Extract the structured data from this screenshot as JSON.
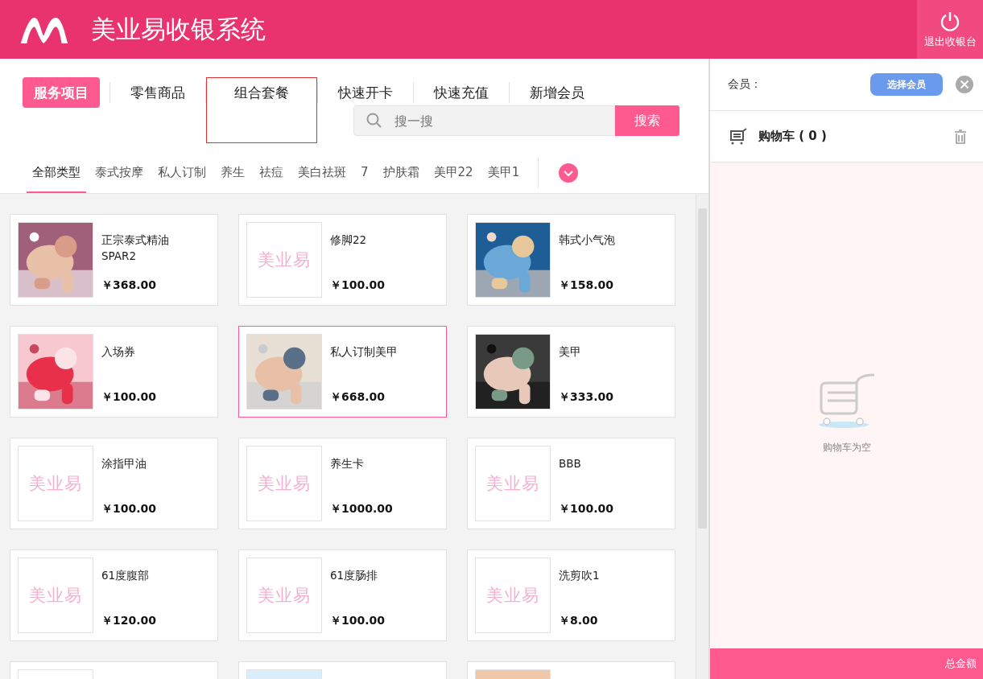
{
  "header": {
    "title": "美业易收银系统",
    "exit_label": "退出收银台"
  },
  "tabs": [
    {
      "label": "服务项目",
      "selected": true,
      "outlined": false
    },
    {
      "label": "零售商品",
      "selected": false,
      "outlined": false
    },
    {
      "label": "组合套餐",
      "selected": false,
      "outlined": true
    },
    {
      "label": "快速开卡",
      "selected": false,
      "outlined": false
    },
    {
      "label": "快速充值",
      "selected": false,
      "outlined": false
    },
    {
      "label": "新增会员",
      "selected": false,
      "outlined": false
    }
  ],
  "search": {
    "placeholder": "搜一搜",
    "button": "搜索"
  },
  "categories": [
    {
      "label": "全部类型",
      "selected": true
    },
    {
      "label": "泰式按摩",
      "selected": false
    },
    {
      "label": "私人订制",
      "selected": false
    },
    {
      "label": "养生",
      "selected": false
    },
    {
      "label": "祛痘",
      "selected": false
    },
    {
      "label": "美白祛斑",
      "selected": false
    },
    {
      "label": "7",
      "selected": false
    },
    {
      "label": "护肤霜",
      "selected": false
    },
    {
      "label": "美甲22",
      "selected": false
    },
    {
      "label": "美甲1",
      "selected": false
    }
  ],
  "products": [
    {
      "name": "正宗泰式精油SPAR2",
      "price": "￥368.00",
      "selected": false
    },
    {
      "name": "修脚22",
      "price": "￥100.00",
      "selected": false,
      "image": {
        "kind": "logo",
        "text": "美业易"
      }
    },
    {
      "name": "韩式小气泡",
      "price": "￥158.00",
      "selected": false
    },
    {
      "name": "入场券",
      "price": "￥100.00",
      "selected": false
    },
    {
      "name": "私人订制美甲",
      "price": "￥668.00",
      "selected": true
    },
    {
      "name": "美甲",
      "price": "￥333.00",
      "selected": false
    },
    {
      "name": "涂指甲油",
      "price": "￥100.00",
      "selected": false,
      "image": {
        "kind": "logo",
        "text": "美业易"
      }
    },
    {
      "name": "养生卡",
      "price": "￥1000.00",
      "selected": false,
      "image": {
        "kind": "logo",
        "text": "美业易"
      }
    },
    {
      "name": "BBB",
      "price": "￥100.00",
      "selected": false,
      "image": {
        "kind": "logo",
        "text": "美业易"
      }
    },
    {
      "name": "61度腹部",
      "price": "￥120.00",
      "selected": false,
      "image": {
        "kind": "logo",
        "text": "美业易"
      }
    },
    {
      "name": "61度肠排",
      "price": "￥100.00",
      "selected": false,
      "image": {
        "kind": "logo",
        "text": "美业易"
      }
    },
    {
      "name": "洗剪吹1",
      "price": "￥8.00",
      "selected": false,
      "image": {
        "kind": "logo",
        "text": "美业易"
      }
    },
    {
      "selected": false,
      "image": {
        "kind": "blank"
      }
    },
    {
      "selected": false
    },
    {
      "selected": false
    }
  ],
  "member": {
    "label": "会员：",
    "button": "选择会员"
  },
  "cart": {
    "title": "购物车 ( 0 )",
    "empty_text": "购物车为空",
    "total_label": "总金额"
  }
}
